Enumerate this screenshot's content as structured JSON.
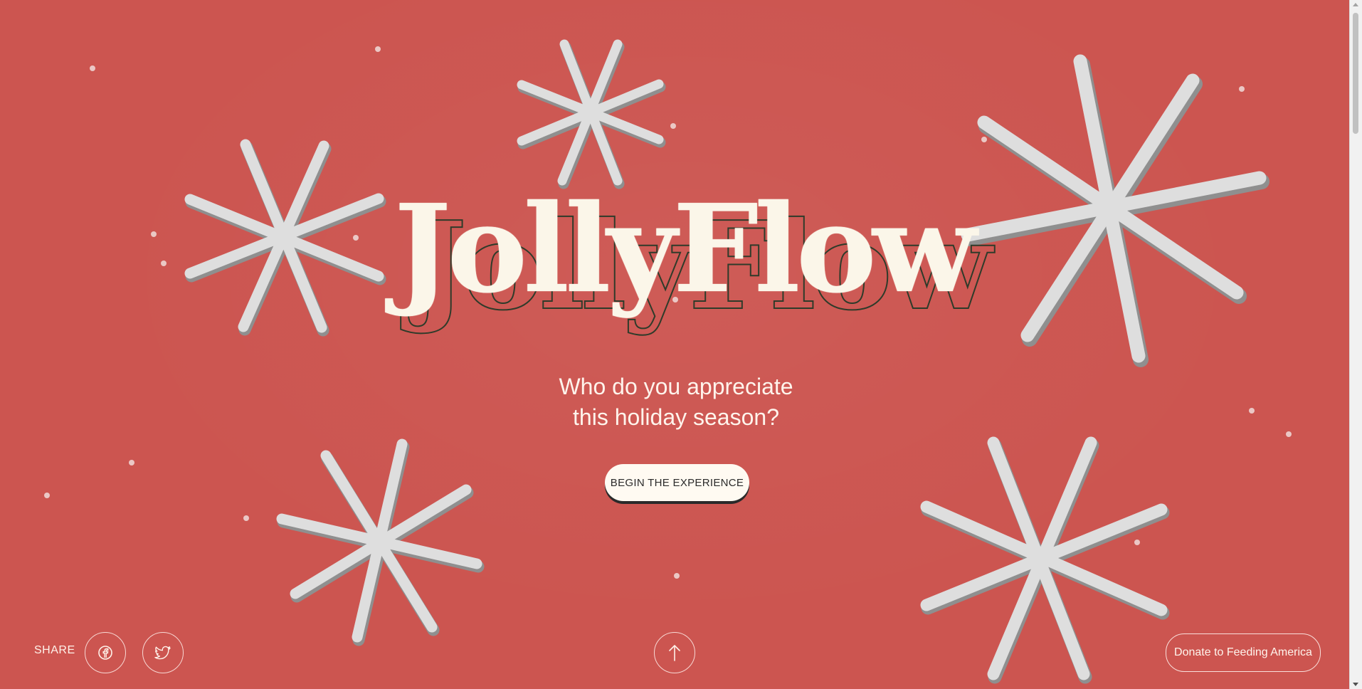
{
  "brand": {
    "logo_text": "JollyFlow",
    "fill_color": "#fbf6e9",
    "outline_color": "#2e3b2a"
  },
  "hero": {
    "tagline_line1": "Who do you appreciate",
    "tagline_line2": "this holiday season?",
    "cta_label": "BEGIN THE EXPERIENCE"
  },
  "footer": {
    "share_label": "SHARE",
    "facebook_icon": "facebook-icon",
    "twitter_icon": "twitter-icon",
    "scroll_icon": "arrow-up-icon",
    "donate_label": "Donate to Feeding America"
  },
  "colors": {
    "background": "#cc5550",
    "snowflake": "#dcdcdc",
    "text": "#fff4ec"
  }
}
